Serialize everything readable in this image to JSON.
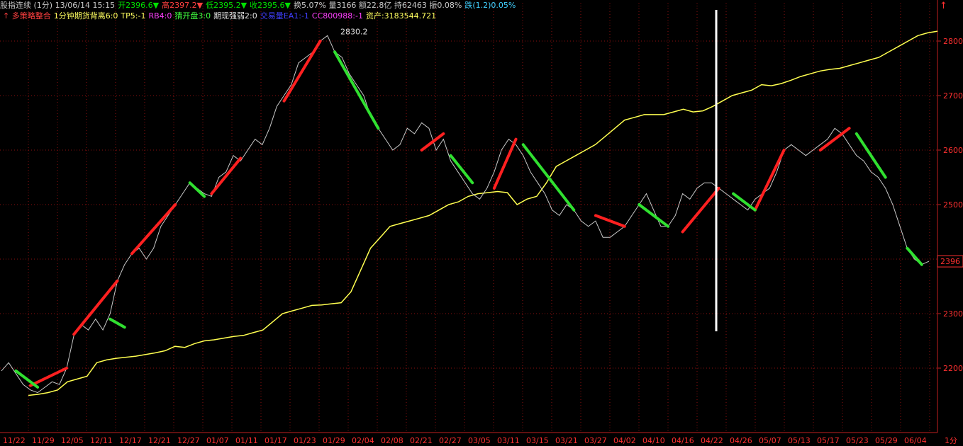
{
  "header": {
    "line1": [
      {
        "text": "股指连续 (1分) 13/06/14 15:15",
        "color": "#c8c8c8"
      },
      {
        "text": "开2396.6▼",
        "color": "#00e000"
      },
      {
        "text": "高2397.2▼",
        "color": "#ff4040"
      },
      {
        "text": "低2395.2▼",
        "color": "#00e000"
      },
      {
        "text": "收2395.6▼",
        "color": "#00e000"
      },
      {
        "text": "换5.07% 量3166 额22.8亿 持62463 振0.08%",
        "color": "#c8c8c8"
      },
      {
        "text": "跌(1.2)0.05%",
        "color": "#40d0ff"
      }
    ],
    "line2": [
      {
        "text": "↑ 多策略整合",
        "color": "#ff4040"
      },
      {
        "text": "1分钟期货背离6:0",
        "color": "#ffff60"
      },
      {
        "text": "TP5:-1",
        "color": "#ffff60"
      },
      {
        "text": "RB4:0",
        "color": "#ff40ff"
      },
      {
        "text": "猜开盘3:0",
        "color": "#40ff40"
      },
      {
        "text": "期现强弱2:0",
        "color": "#e0e0e0"
      },
      {
        "text": "交易量EA1:-1",
        "color": "#4040ff"
      },
      {
        "text": "CC800988:-1",
        "color": "#ff40ff"
      },
      {
        "text": "资产:3183544.721",
        "color": "#ffff60"
      }
    ],
    "top_arrow": "↑"
  },
  "chart_data": {
    "type": "line",
    "title": "",
    "xlabel": "",
    "ylabel": "",
    "ylim": [
      2150,
      2850
    ],
    "y_ticks": [
      2200,
      2300,
      2400,
      2500,
      2600,
      2700,
      2800
    ],
    "current_price_label": "2396",
    "current_price": 2396,
    "peak_label": "2830.2",
    "peak_value": 2830.2,
    "x_tick_labels": [
      "11/22",
      "11/29",
      "12/05",
      "12/11",
      "12/17",
      "12/21",
      "12/27",
      "01/07",
      "01/11",
      "01/17",
      "01/23",
      "01/29",
      "02/04",
      "02/08",
      "02/21",
      "02/27",
      "03/05",
      "03/11",
      "03/15",
      "03/21",
      "03/27",
      "04/02",
      "04/10",
      "04/16",
      "04/22",
      "04/26",
      "05/07",
      "05/13",
      "05/17",
      "05/23",
      "05/29",
      "06/04"
    ],
    "x_tail_label": "1分",
    "series": [
      {
        "role": "price",
        "color": "#c8c8c8",
        "values": [
          2195,
          2210,
          2190,
          2170,
          2160,
          2155,
          2165,
          2175,
          2170,
          2200,
          2260,
          2280,
          2270,
          2290,
          2270,
          2300,
          2360,
          2390,
          2410,
          2420,
          2400,
          2420,
          2460,
          2480,
          2500,
          2520,
          2540,
          2530,
          2520,
          2515,
          2550,
          2560,
          2590,
          2580,
          2600,
          2620,
          2610,
          2640,
          2680,
          2700,
          2720,
          2760,
          2770,
          2780,
          2800,
          2810,
          2780,
          2770,
          2740,
          2720,
          2700,
          2660,
          2640,
          2620,
          2600,
          2610,
          2640,
          2630,
          2650,
          2640,
          2600,
          2620,
          2580,
          2560,
          2540,
          2520,
          2510,
          2530,
          2560,
          2600,
          2620,
          2610,
          2590,
          2560,
          2540,
          2520,
          2490,
          2480,
          2500,
          2490,
          2470,
          2460,
          2470,
          2440,
          2440,
          2450,
          2460,
          2480,
          2500,
          2520,
          2490,
          2460,
          2460,
          2480,
          2520,
          2510,
          2530,
          2540,
          2540,
          2530,
          2520,
          2510,
          2500,
          2490,
          2510,
          2520,
          2530,
          2560,
          2600,
          2610,
          2600,
          2590,
          2600,
          2610,
          2620,
          2640,
          2630,
          2610,
          2590,
          2580,
          2560,
          2550,
          2530,
          2500,
          2460,
          2420,
          2400,
          2390,
          2396
        ]
      },
      {
        "role": "equity",
        "color": "#ffff50",
        "values": [
          2150,
          2152,
          2155,
          2160,
          2175,
          2180,
          2185,
          2210,
          2215,
          2218,
          2220,
          2222,
          2225,
          2228,
          2232,
          2240,
          2238,
          2245,
          2250,
          2252,
          2255,
          2258,
          2260,
          2265,
          2270,
          2285,
          2300,
          2305,
          2310,
          2315,
          2316,
          2318,
          2320,
          2340,
          2380,
          2420,
          2440,
          2460,
          2465,
          2470,
          2475,
          2480,
          2490,
          2500,
          2505,
          2515,
          2520,
          2522,
          2524,
          2522,
          2500,
          2510,
          2515,
          2540,
          2570,
          2580,
          2590,
          2600,
          2610,
          2625,
          2640,
          2655,
          2660,
          2665,
          2665,
          2665,
          2670,
          2675,
          2670,
          2672,
          2680,
          2690,
          2700,
          2705,
          2710,
          2720,
          2718,
          2722,
          2728,
          2735,
          2740,
          2745,
          2748,
          2750,
          2755,
          2760,
          2765,
          2770,
          2780,
          2790,
          2800,
          2810,
          2815,
          2818
        ]
      },
      {
        "role": "buy-trades",
        "color": "#ff2020",
        "segments": [
          [
            [
              4,
              2168
            ],
            [
              9,
              2200
            ]
          ],
          [
            [
              10,
              2262
            ],
            [
              16,
              2360
            ]
          ],
          [
            [
              18,
              2410
            ],
            [
              24,
              2500
            ]
          ],
          [
            [
              29,
              2520
            ],
            [
              33,
              2585
            ]
          ],
          [
            [
              39,
              2690
            ],
            [
              44,
              2800
            ]
          ],
          [
            [
              58,
              2600
            ],
            [
              61,
              2630
            ]
          ],
          [
            [
              68,
              2530
            ],
            [
              71,
              2620
            ]
          ],
          [
            [
              82,
              2480
            ],
            [
              86,
              2460
            ]
          ],
          [
            [
              94,
              2450
            ],
            [
              99,
              2530
            ]
          ],
          [
            [
              104,
              2490
            ],
            [
              108,
              2600
            ]
          ],
          [
            [
              113,
              2600
            ],
            [
              117,
              2640
            ]
          ]
        ]
      },
      {
        "role": "sell-trades",
        "color": "#30e030",
        "segments": [
          [
            [
              2,
              2195
            ],
            [
              5,
              2165
            ]
          ],
          [
            [
              15,
              2290
            ],
            [
              17,
              2275
            ]
          ],
          [
            [
              26,
              2540
            ],
            [
              28,
              2515
            ]
          ],
          [
            [
              46,
              2780
            ],
            [
              52,
              2640
            ]
          ],
          [
            [
              62,
              2590
            ],
            [
              65,
              2540
            ]
          ],
          [
            [
              72,
              2610
            ],
            [
              79,
              2490
            ]
          ],
          [
            [
              88,
              2500
            ],
            [
              92,
              2460
            ]
          ],
          [
            [
              101,
              2520
            ],
            [
              104,
              2490
            ]
          ],
          [
            [
              118,
              2630
            ],
            [
              122,
              2550
            ]
          ],
          [
            [
              125,
              2420
            ],
            [
              127,
              2390
            ]
          ]
        ]
      }
    ]
  }
}
